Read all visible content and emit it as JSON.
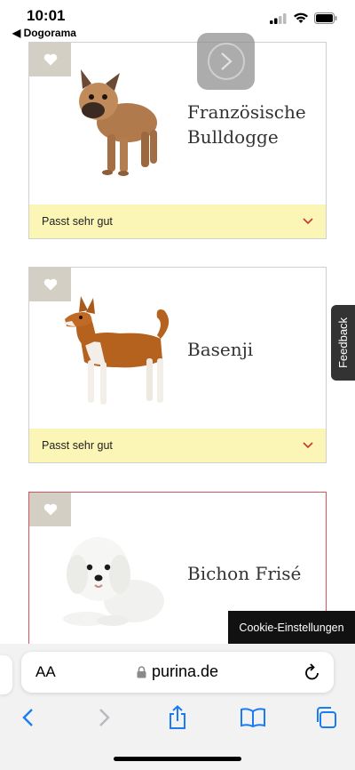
{
  "status_bar": {
    "time": "10:01",
    "back_app": "◀ Dogorama"
  },
  "cards": [
    {
      "name": "Französische Bulldogge",
      "name_line1": "Französische",
      "name_line2": "Bulldogge",
      "fit": "Passt sehr gut",
      "image": "french-bulldog"
    },
    {
      "name": "Basenji",
      "fit": "Passt sehr gut",
      "image": "basenji"
    },
    {
      "name": "Bichon Frisé",
      "image": "bichon-frise"
    }
  ],
  "feedback": {
    "label": "Feedback"
  },
  "cookie": {
    "label": "Cookie-Einstellungen"
  },
  "browser": {
    "aa": "AA",
    "url": "purina.de"
  },
  "colors": {
    "fit_bg": "#fbf5b6",
    "accent_red": "#d9535e",
    "fav_bg": "#d3cfc5",
    "ios_blue": "#1a7cf5"
  },
  "icons": [
    "heart-icon",
    "chevron-down-icon",
    "next-arrow-icon",
    "lock-icon",
    "reload-icon",
    "back-icon",
    "forward-icon",
    "share-icon",
    "bookmarks-icon",
    "tabs-icon"
  ]
}
